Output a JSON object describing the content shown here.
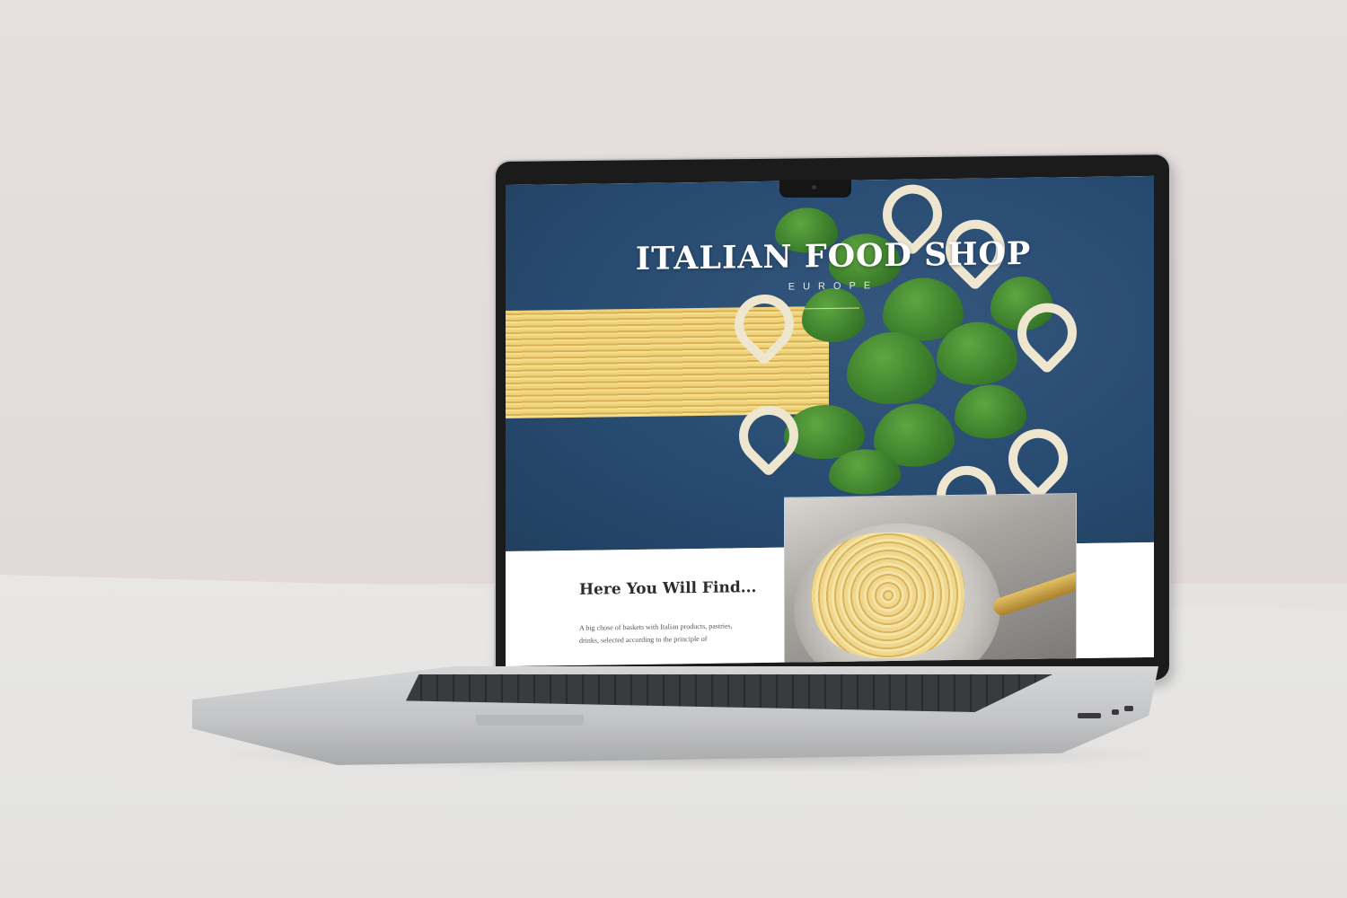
{
  "site": {
    "title": "ITALIAN FOOD SHOP",
    "subtitle": "EUROPE"
  },
  "section": {
    "heading": "Here You Will Find...",
    "body": "A big chose of baskets with Italian products, pastries, drinks, selected according to the principle of"
  },
  "colors": {
    "hero_background": "#274a70",
    "accent_rule": "#e8d2a8",
    "heading_text": "#2c2c2c"
  }
}
